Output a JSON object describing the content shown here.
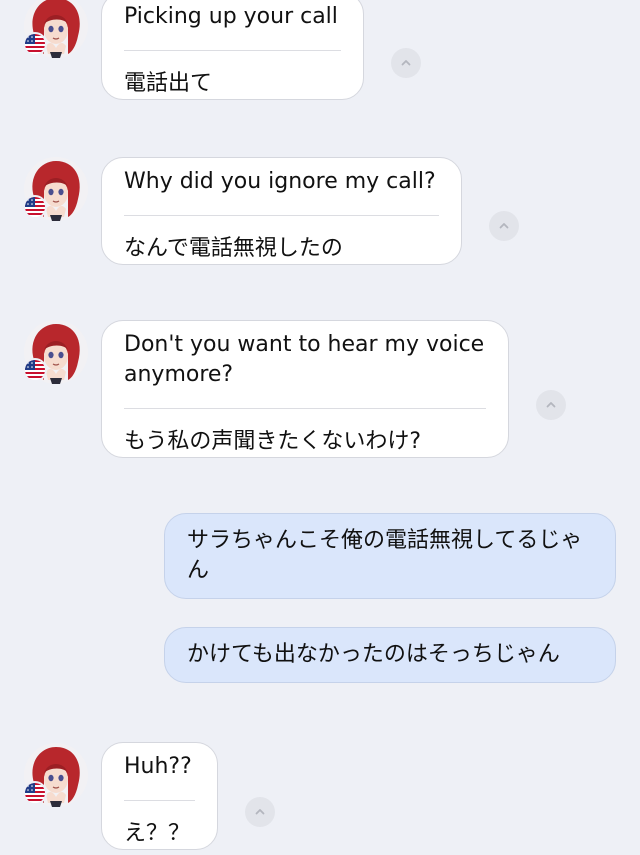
{
  "messages": [
    {
      "direction": "incoming",
      "original": "Picking up your call",
      "translation": "電話出て"
    },
    {
      "direction": "incoming",
      "original": "Why did you ignore my call?",
      "translation": "なんで電話無視したの"
    },
    {
      "direction": "incoming",
      "original": "Don't you want to hear my voice anymore?",
      "translation": "もう私の声聞きたくないわけ?"
    },
    {
      "direction": "outgoing",
      "text": "サラちゃんこそ俺の電話無視してるじゃん"
    },
    {
      "direction": "outgoing",
      "text": "かけても出なかったのはそっちじゃん"
    },
    {
      "direction": "incoming",
      "original": "Huh??",
      "translation": "え？？"
    }
  ],
  "icons": {
    "avatar": "character-avatar",
    "flag": "us-flag-icon",
    "collapse": "chevron-up-icon"
  },
  "colors": {
    "background": "#eef0f6",
    "incoming_bubble": "#ffffff",
    "outgoing_bubble": "#dae6fb",
    "collapse_button": "#e2e4ea"
  }
}
